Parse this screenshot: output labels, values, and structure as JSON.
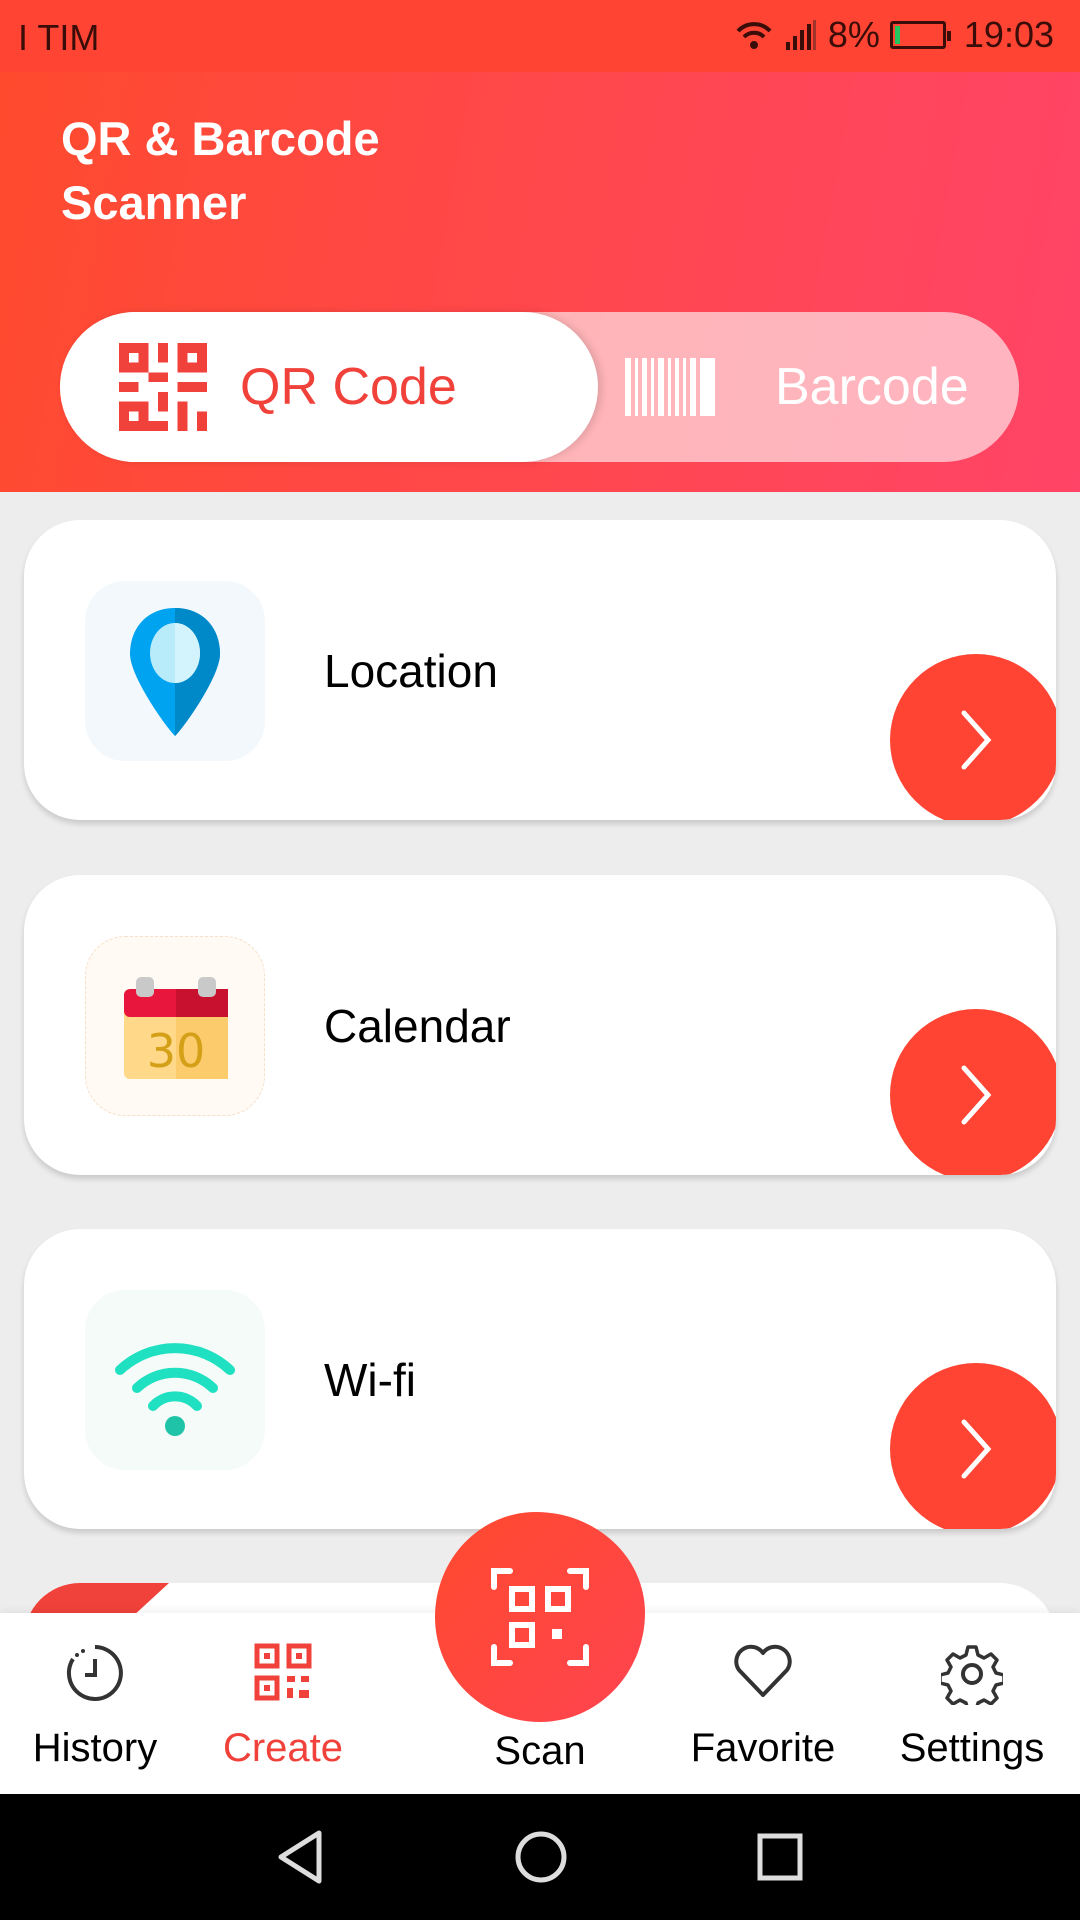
{
  "status_bar": {
    "carrier": "I TIM",
    "battery": "8%",
    "time": "19:03"
  },
  "header": {
    "title_line1": "QR & Barcode",
    "title_line2": "Scanner"
  },
  "toggle": {
    "options": [
      {
        "label": "QR Code",
        "selected": true
      },
      {
        "label": "Barcode",
        "selected": false
      }
    ]
  },
  "cards": [
    {
      "label": "Location",
      "icon": "location-pin-icon"
    },
    {
      "label": "Calendar",
      "icon": "calendar-icon",
      "icon_text": "30"
    },
    {
      "label": "Wi-fi",
      "icon": "wifi-icon"
    }
  ],
  "bottom_nav": {
    "items": [
      {
        "label": "History",
        "icon": "clock-icon",
        "active": false
      },
      {
        "label": "Create",
        "icon": "qr-grid-icon",
        "active": true
      },
      {
        "label": "Scan",
        "icon": "scan-qr-icon",
        "active": false
      },
      {
        "label": "Favorite",
        "icon": "heart-icon",
        "active": false
      },
      {
        "label": "Settings",
        "icon": "gear-icon",
        "active": false
      }
    ]
  },
  "colors": {
    "accent": "#ff4433",
    "active_tab": "#f0413a",
    "text": "#000000"
  }
}
